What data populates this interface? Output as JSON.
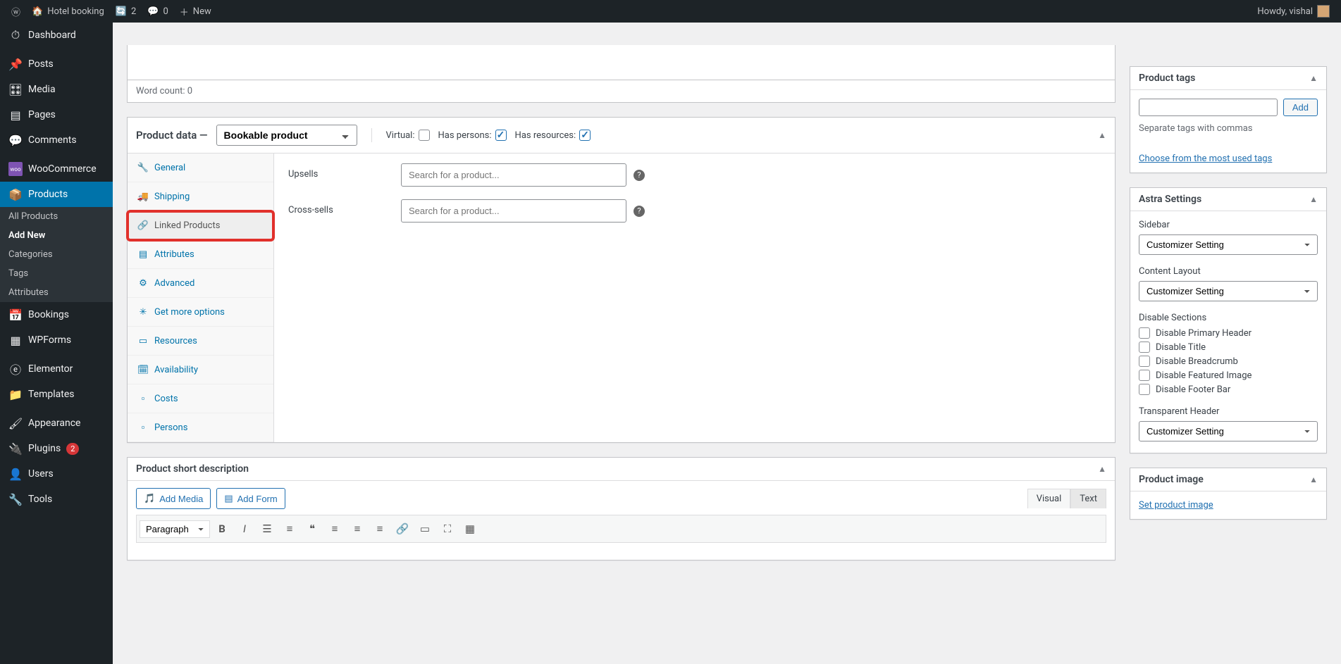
{
  "adminBar": {
    "siteName": "Hotel booking",
    "updatesCount": "2",
    "commentsCount": "0",
    "newLabel": "New",
    "greeting": "Howdy, vishal"
  },
  "sidebar": {
    "dashboard": "Dashboard",
    "posts": "Posts",
    "media": "Media",
    "pages": "Pages",
    "comments": "Comments",
    "woocommerce": "WooCommerce",
    "products": "Products",
    "productsSub": {
      "all": "All Products",
      "addNew": "Add New",
      "categories": "Categories",
      "tags": "Tags",
      "attributes": "Attributes"
    },
    "bookings": "Bookings",
    "wpforms": "WPForms",
    "elementor": "Elementor",
    "templates": "Templates",
    "appearance": "Appearance",
    "plugins": "Plugins",
    "pluginsCount": "2",
    "users": "Users",
    "tools": "Tools"
  },
  "wordCount": "Word count: 0",
  "productData": {
    "title": "Product data —",
    "typeSelected": "Bookable product",
    "virtualLabel": "Virtual:",
    "hasPersonsLabel": "Has persons:",
    "hasResourcesLabel": "Has resources:",
    "tabs": {
      "general": "General",
      "shipping": "Shipping",
      "linked": "Linked Products",
      "attributes": "Attributes",
      "advanced": "Advanced",
      "getMore": "Get more options",
      "resources": "Resources",
      "availability": "Availability",
      "costs": "Costs",
      "persons": "Persons"
    },
    "upsellsLabel": "Upsells",
    "crossSellsLabel": "Cross-sells",
    "searchPlaceholder": "Search for a product..."
  },
  "shortDesc": {
    "title": "Product short description",
    "addMedia": "Add Media",
    "addForm": "Add Form",
    "visual": "Visual",
    "text": "Text",
    "paragraph": "Paragraph"
  },
  "productTags": {
    "title": "Product tags",
    "addBtn": "Add",
    "hint": "Separate tags with commas",
    "chooseLink": "Choose from the most used tags"
  },
  "astra": {
    "title": "Astra Settings",
    "sidebarLabel": "Sidebar",
    "sidebarValue": "Customizer Setting",
    "contentLayoutLabel": "Content Layout",
    "contentLayoutValue": "Customizer Setting",
    "disableSectionsLabel": "Disable Sections",
    "disablePrimary": "Disable Primary Header",
    "disableTitle": "Disable Title",
    "disableBreadcrumb": "Disable Breadcrumb",
    "disableFeatured": "Disable Featured Image",
    "disableFooter": "Disable Footer Bar",
    "transparentLabel": "Transparent Header",
    "transparentValue": "Customizer Setting"
  },
  "productImage": {
    "title": "Product image",
    "setLink": "Set product image"
  }
}
